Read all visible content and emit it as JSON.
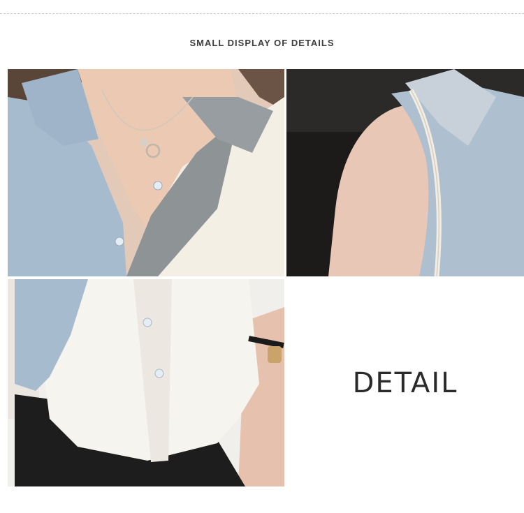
{
  "header": {
    "title": "SMALL DISPLAY OF DETAILS"
  },
  "gallery": {
    "photos": [
      {
        "id": "collar",
        "subject": "neckline and collar with pendant necklace"
      },
      {
        "id": "shoulder",
        "subject": "sleeveless shoulder and collar side view"
      },
      {
        "id": "hem",
        "subject": "shirt hem with buttons and watch"
      }
    ],
    "detail_label": "DETAIL"
  },
  "colors": {
    "blue_fabric": "#a9bccf",
    "grey_fabric": "#8f9497",
    "cream_fabric": "#f3eee4",
    "skin": "#e9c6b2",
    "black_trousers": "#1e1e1e"
  }
}
